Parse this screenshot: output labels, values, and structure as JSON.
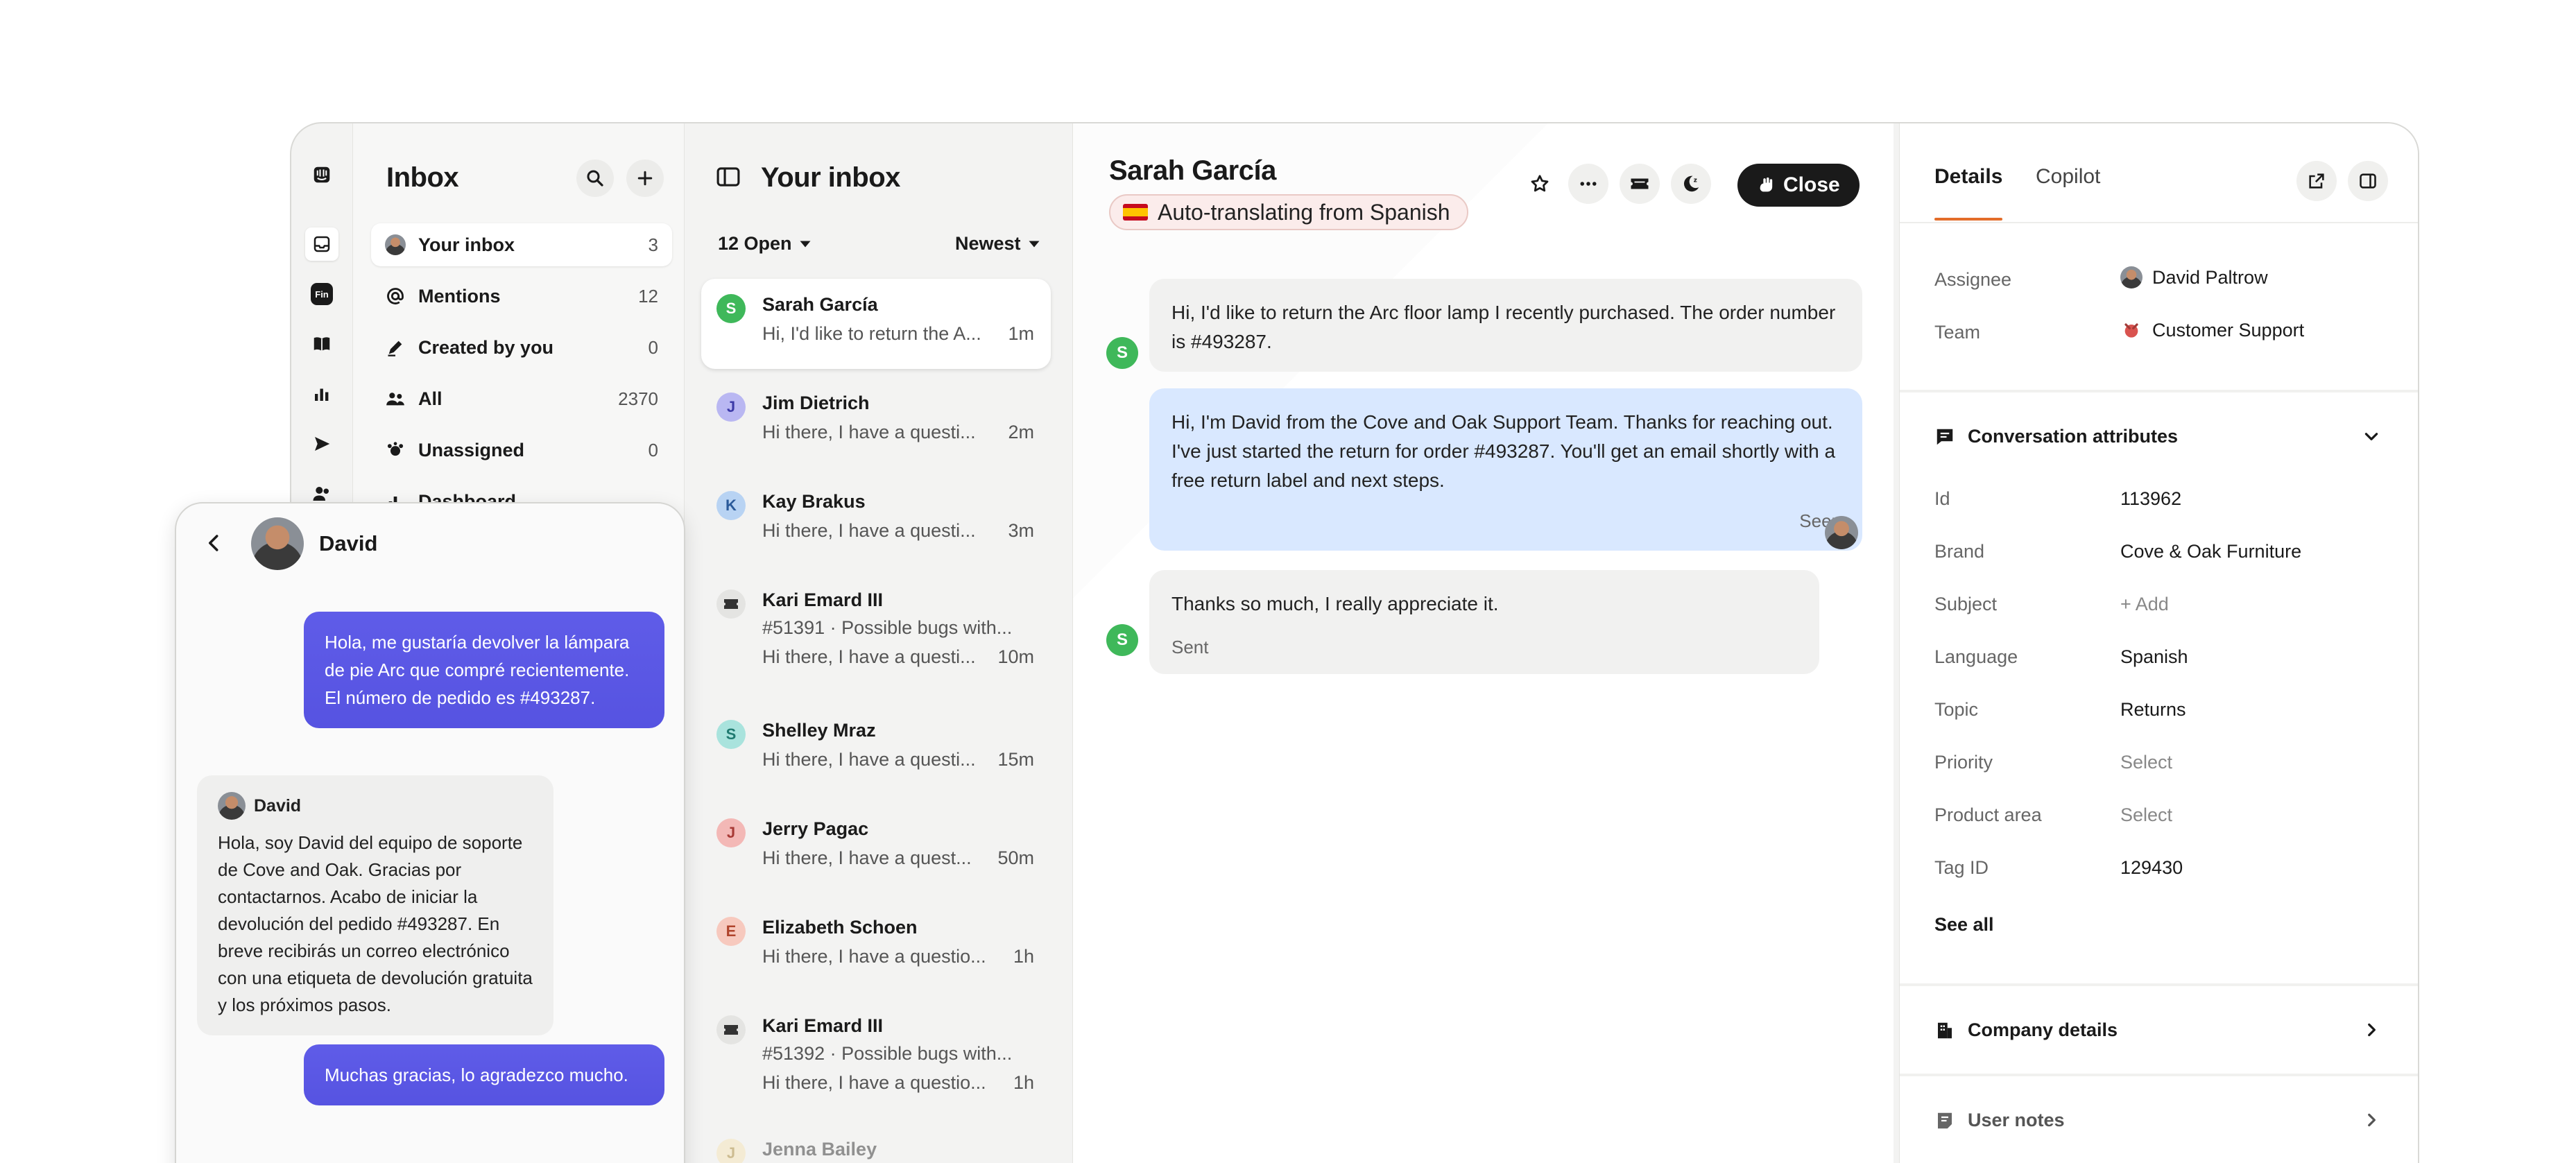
{
  "colors": {
    "accent": "#5653e1",
    "tab_underline": "#e36d2a",
    "close_button": "#1a1a1a",
    "agent_bubble": "#d9e8ff"
  },
  "rail": {
    "icons": [
      "logo-icon",
      "inbox-icon",
      "fin-icon",
      "book-icon",
      "reports-icon",
      "outbound-icon",
      "contacts-icon"
    ],
    "fin_label": "Fin"
  },
  "inbox": {
    "title": "Inbox",
    "items": [
      {
        "label": "Your inbox",
        "count": "3",
        "icon": "avatar"
      },
      {
        "label": "Mentions",
        "count": "12",
        "icon": "at-icon"
      },
      {
        "label": "Created by you",
        "count": "0",
        "icon": "pen-icon"
      },
      {
        "label": "All",
        "count": "2370",
        "icon": "people-icon"
      },
      {
        "label": "Unassigned",
        "count": "0",
        "icon": "unassigned-icon"
      },
      {
        "label": "Dashboard",
        "count": "",
        "icon": "chart-icon"
      }
    ]
  },
  "list": {
    "title": "Your inbox",
    "filter_open": "12 Open",
    "sort": "Newest",
    "conversations": [
      {
        "initial": "S",
        "name": "Sarah García",
        "line1": "Hi, I'd like to return the A...",
        "line2": "",
        "time": "1m",
        "color": "#3fb85a",
        "text_color": "#ffffff"
      },
      {
        "initial": "J",
        "name": "Jim Dietrich",
        "line1": "Hi there, I have a questi...",
        "line2": "",
        "time": "2m",
        "color": "#b9b7f2",
        "text_color": "#3c3aa8"
      },
      {
        "initial": "K",
        "name": "Kay Brakus",
        "line1": "Hi there, I have a questi...",
        "line2": "",
        "time": "3m",
        "color": "#b8d3f3",
        "text_color": "#2a5a9a"
      },
      {
        "initial": "",
        "name": "Kari Emard III",
        "line1": "#51391 · Possible bugs with...",
        "line2": "Hi there, I have a questi...",
        "time": "10m",
        "color": "#e4e4e2",
        "text_color": "#333333"
      },
      {
        "initial": "S",
        "name": "Shelley Mraz",
        "line1": "Hi there, I have a questi...",
        "line2": "",
        "time": "15m",
        "color": "#a9e3dd",
        "text_color": "#1f7a70"
      },
      {
        "initial": "J",
        "name": "Jerry Pagac",
        "line1": "Hi there, I have a quest...",
        "line2": "",
        "time": "50m",
        "color": "#f3b8b6",
        "text_color": "#a83a36"
      },
      {
        "initial": "E",
        "name": "Elizabeth Schoen",
        "line1": "Hi there, I have a questio...",
        "line2": "",
        "time": "1h",
        "color": "#f7c9be",
        "text_color": "#b0442c"
      },
      {
        "initial": "",
        "name": "Kari Emard III",
        "line1": "#51392 · Possible bugs with...",
        "line2": "Hi there, I have a questio...",
        "time": "1h",
        "color": "#e4e4e2",
        "text_color": "#333333"
      },
      {
        "initial": "J",
        "name": "Jenna Bailey",
        "line1": "",
        "line2": "",
        "time": "",
        "color": "#f7e3b0",
        "text_color": "#a07a1c"
      }
    ]
  },
  "conversation": {
    "title": "Sarah García",
    "translate_label": "Auto-translating from Spanish",
    "close_label": "Close",
    "messages": [
      {
        "from": "customer",
        "text": "Hi, I'd like to return the Arc floor lamp I recently purchased. The order number is #493287.",
        "avatar": "S"
      },
      {
        "from": "agent",
        "text": "Hi, I'm David from the Cove and Oak Support Team. Thanks for reaching out. I've just started the return for order #493287. You'll get an email shortly with a free return label and next steps.",
        "status": "Seen"
      },
      {
        "from": "customer",
        "text": "Thanks so much, I really appreciate it.",
        "status": "Sent",
        "avatar": "S"
      }
    ]
  },
  "details": {
    "tabs": [
      "Details",
      "Copilot"
    ],
    "assignee_label": "Assignee",
    "assignee_value": "David Paltrow",
    "team_label": "Team",
    "team_value": "Customer Support",
    "attributes_title": "Conversation attributes",
    "attributes": [
      {
        "label": "Id",
        "value": "113962",
        "muted": false
      },
      {
        "label": "Brand",
        "value": "Cove & Oak Furniture",
        "muted": false
      },
      {
        "label": "Subject",
        "value": "+ Add",
        "muted": true
      },
      {
        "label": "Language",
        "value": "Spanish",
        "muted": false
      },
      {
        "label": "Topic",
        "value": "Returns",
        "muted": false
      },
      {
        "label": "Priority",
        "value": "Select",
        "muted": true
      },
      {
        "label": "Product area",
        "value": "Select",
        "muted": true
      },
      {
        "label": "Tag ID",
        "value": "129430",
        "muted": false
      }
    ],
    "see_all": "See all",
    "company_details": "Company details",
    "user_notes": "User notes"
  },
  "messenger": {
    "agent_name": "David",
    "messages": [
      {
        "from": "me",
        "text": "Hola, me gustaría devolver la lámpara de pie Arc que compré recientemente. El número de pedido es #493287."
      },
      {
        "from": "them",
        "sender": "David",
        "text": "Hola, soy David del equipo de soporte de Cove and Oak. Gracias por contactarnos. Acabo de iniciar la devolución del pedido #493287. En breve recibirás un correo electrónico con una etiqueta de devolución gratuita y los próximos pasos."
      },
      {
        "from": "me",
        "text": "Muchas gracias, lo agradezco mucho."
      }
    ]
  }
}
